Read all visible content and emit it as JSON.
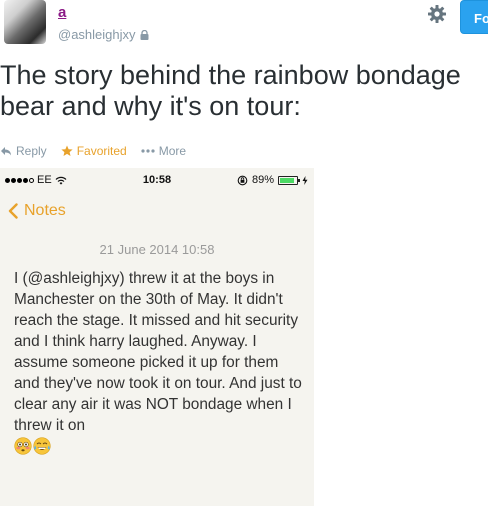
{
  "header": {
    "display_name": "a",
    "screen_name": "@ashleighjxy",
    "follow_label": "Follow"
  },
  "tweet": {
    "text": "The story behind the rainbow bondage bear and why it's on tour:"
  },
  "actions": {
    "reply": "Reply",
    "favorited": "Favorited",
    "more": "More"
  },
  "phone": {
    "carrier": "EE",
    "time": "10:58",
    "battery": "89%",
    "battery_level": 0.89,
    "back_label": "Notes",
    "note_date": "21 June 2014 10:58",
    "note_text": "I (@ashleighjxy) threw it at the boys in Manchester on the 30th of May. It didn't reach the stage. It missed and hit security and I think harry laughed. Anyway. I assume someone picked it up for them and they've now took it on tour. And just to clear any air it was NOT bondage when I threw it on",
    "emojis": [
      "flushed-face-emoji",
      "tears-of-joy-emoji"
    ]
  },
  "colors": {
    "accent_notes": "#e8a22b",
    "follow_blue": "#2aa2ef",
    "name_purple": "#8b1a86"
  }
}
